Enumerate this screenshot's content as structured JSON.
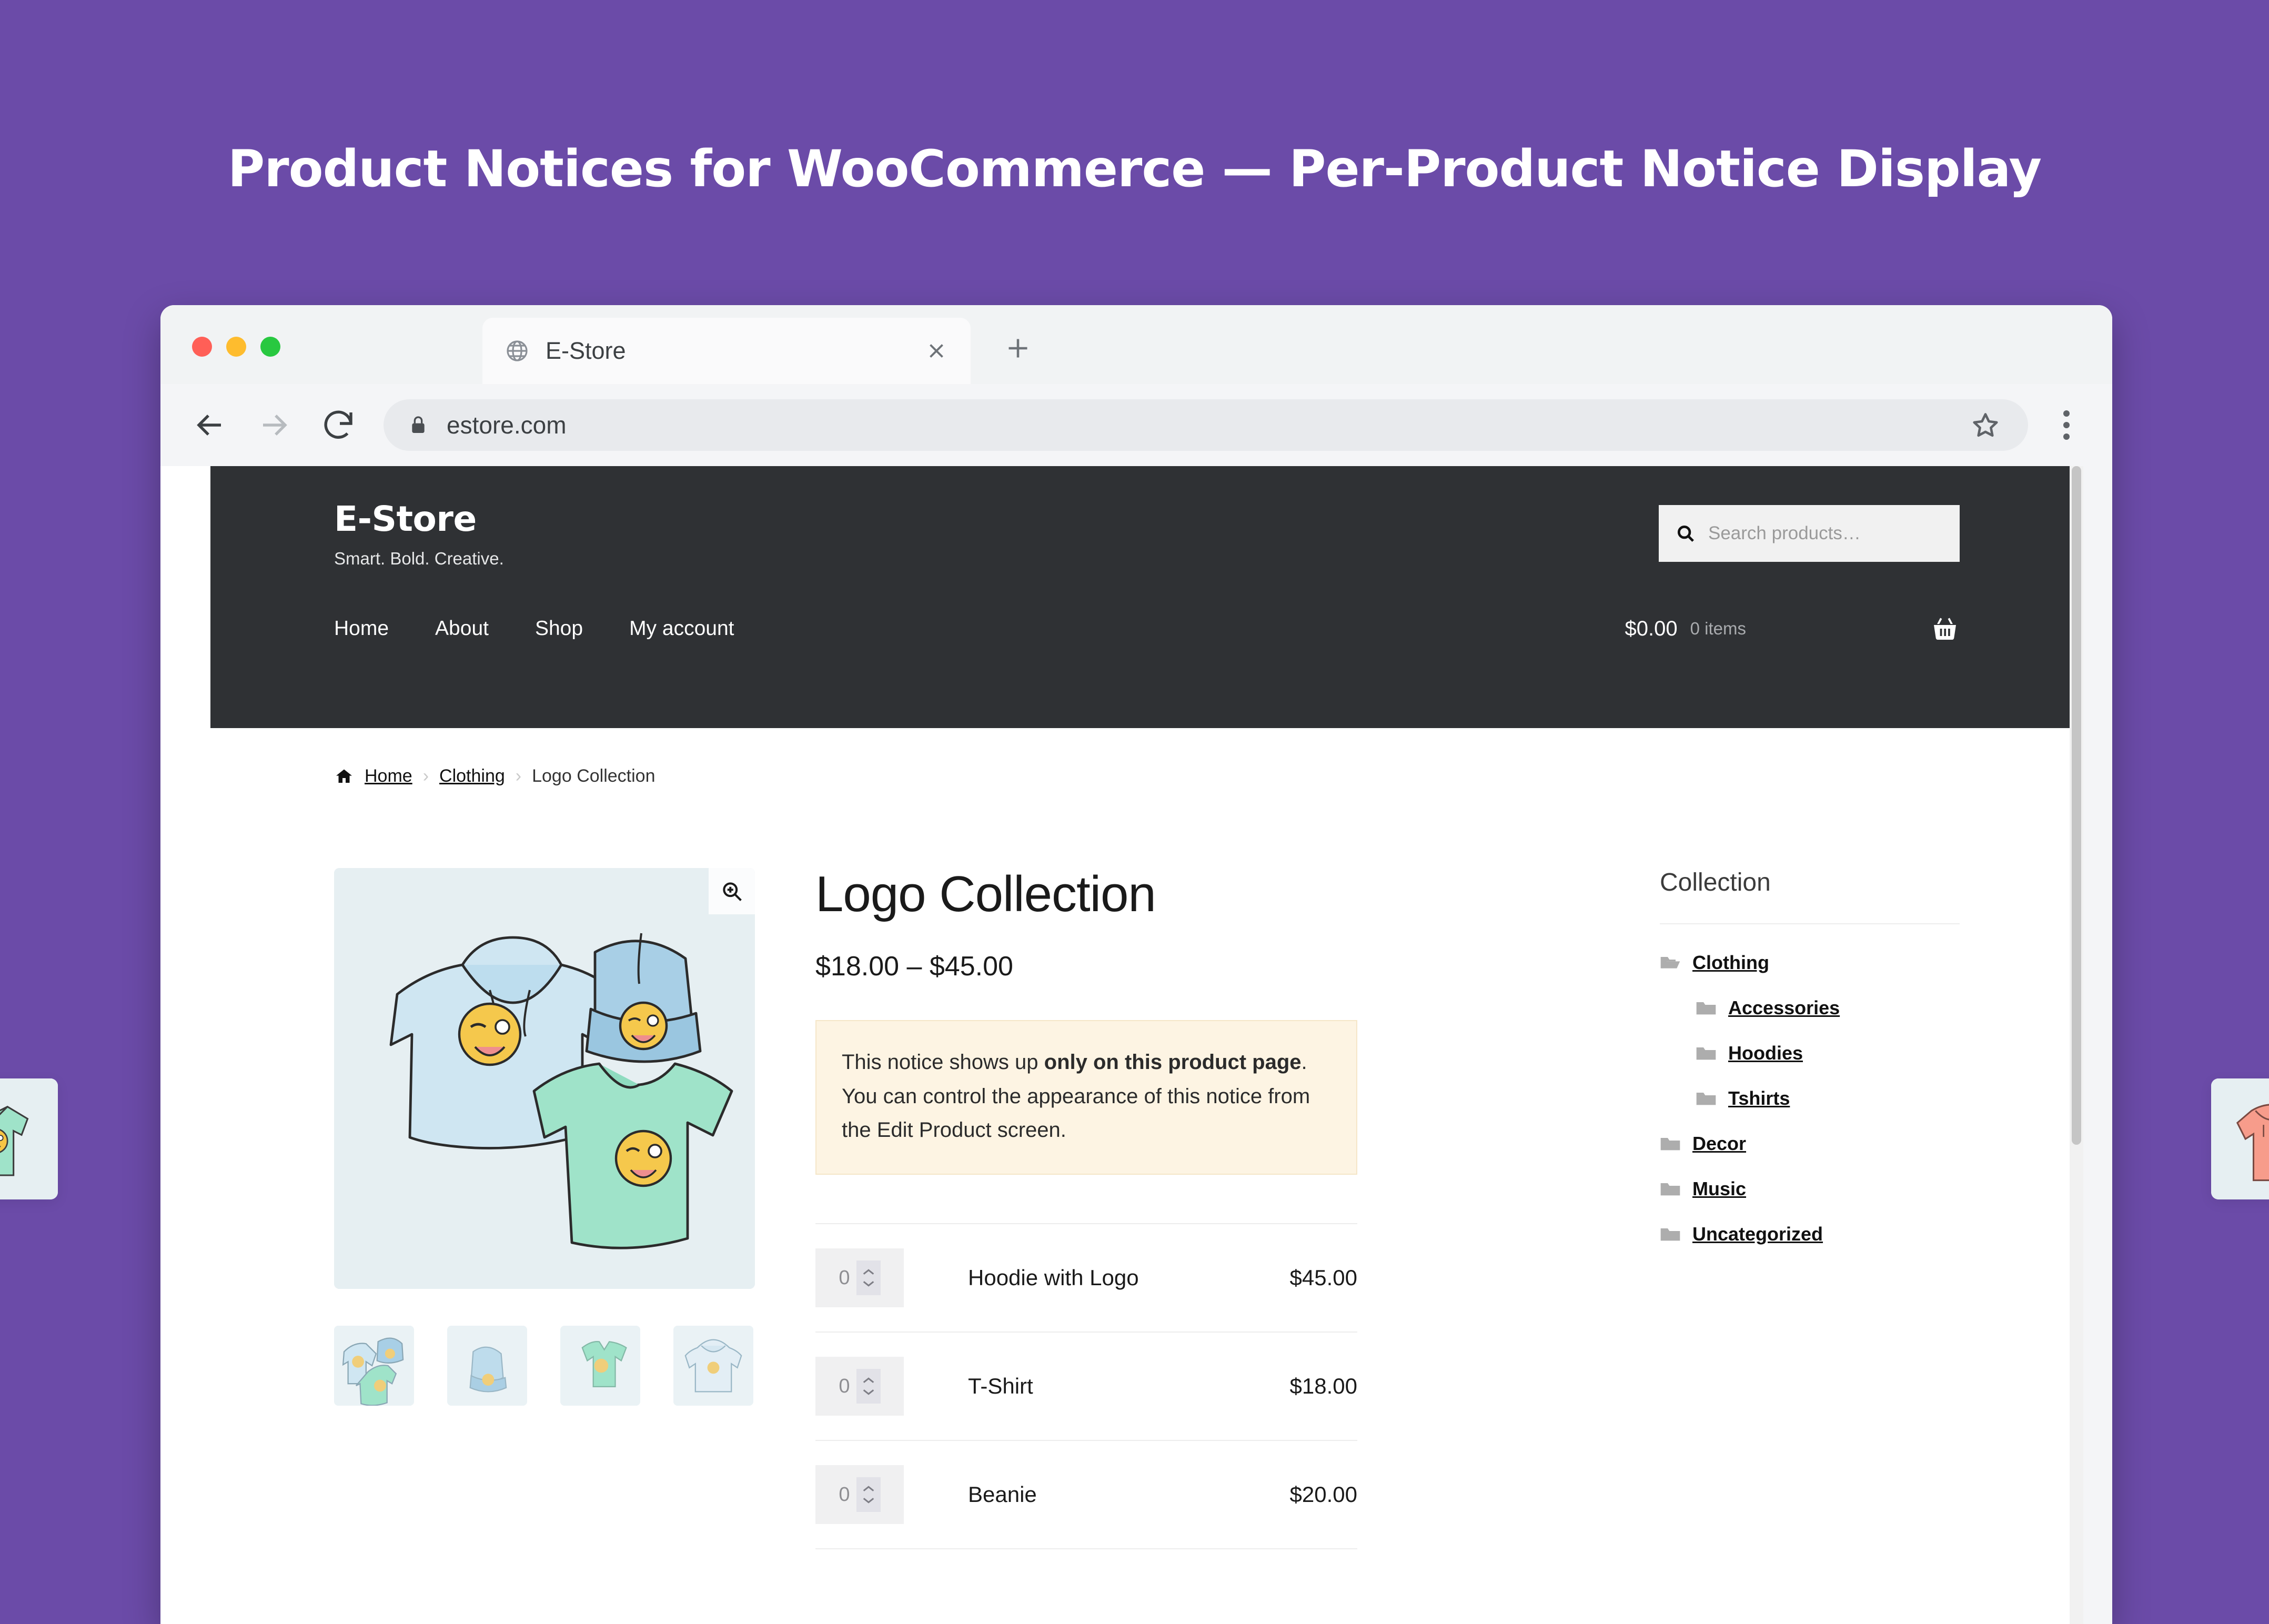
{
  "banner": {
    "title": "Product Notices for WooCommerce — Per-Product Notice Display",
    "background_color": "#6B4BA8",
    "text_color": "#FFFFFF"
  },
  "browser": {
    "traffic_lights": [
      "close",
      "minimize",
      "maximize"
    ],
    "tab": {
      "title": "E-Store",
      "favicon": "globe-icon",
      "close_label": "×"
    },
    "new_tab_label": "+",
    "toolbar": {
      "back": "←",
      "forward": "→",
      "reload": "⟳",
      "lock": "lock-icon",
      "url": "estore.com",
      "bookmark": "star-icon",
      "menu": "kebab-menu-icon"
    }
  },
  "site": {
    "title": "E-Store",
    "tagline": "Smart. Bold. Creative.",
    "header_bg": "#2F3134",
    "search": {
      "placeholder": "Search products…",
      "icon": "search-icon"
    },
    "nav": [
      {
        "label": "Home"
      },
      {
        "label": "About"
      },
      {
        "label": "Shop"
      },
      {
        "label": "My account"
      }
    ],
    "cart": {
      "total": "$0.00",
      "count": "0 items",
      "icon": "shopping-basket-icon"
    }
  },
  "breadcrumb": {
    "home_icon": "home-icon",
    "items": [
      {
        "label": "Home",
        "link": true
      },
      {
        "label": "Clothing",
        "link": true
      },
      {
        "label": "Logo Collection",
        "link": false
      }
    ],
    "separator": "›"
  },
  "product": {
    "title": "Logo Collection",
    "price_range": "$18.00 – $45.00",
    "gallery": {
      "zoom_icon": "magnifier-plus-icon",
      "main_alt": "hoodie, beanie and t-shirt with winking emoji logo",
      "thumbnails": [
        {
          "alt": "group of logo products"
        },
        {
          "alt": "beanie with logo"
        },
        {
          "alt": "t-shirt with logo"
        },
        {
          "alt": "hoodie with logo"
        }
      ]
    },
    "notice": {
      "text_before": "This notice shows up ",
      "text_bold": "only on this product page",
      "text_after": ". You can control the appearance of this notice from the Edit Product screen.",
      "background_color": "#FDF4E3",
      "border_color": "#F5E6C8"
    },
    "grouped_items": [
      {
        "qty": "0",
        "name": "Hoodie with Logo",
        "price": "$45.00"
      },
      {
        "qty": "0",
        "name": "T-Shirt",
        "price": "$18.00"
      },
      {
        "qty": "0",
        "name": "Beanie",
        "price": "$20.00"
      }
    ]
  },
  "sidebar": {
    "widget_title": "Collection",
    "categories": [
      {
        "label": "Clothing",
        "level": 0,
        "icon": "folder-open-icon"
      },
      {
        "label": "Accessories",
        "level": 1,
        "icon": "folder-icon"
      },
      {
        "label": "Hoodies",
        "level": 1,
        "icon": "folder-icon"
      },
      {
        "label": "Tshirts",
        "level": 1,
        "icon": "folder-icon"
      },
      {
        "label": "Decor",
        "level": 0,
        "icon": "folder-icon"
      },
      {
        "label": "Music",
        "level": 0,
        "icon": "folder-icon"
      },
      {
        "label": "Uncategorized",
        "level": 0,
        "icon": "folder-icon"
      }
    ]
  },
  "peek_cards": {
    "left_alt": "green t-shirt product card",
    "right_alt": "pink hoodie product card"
  }
}
